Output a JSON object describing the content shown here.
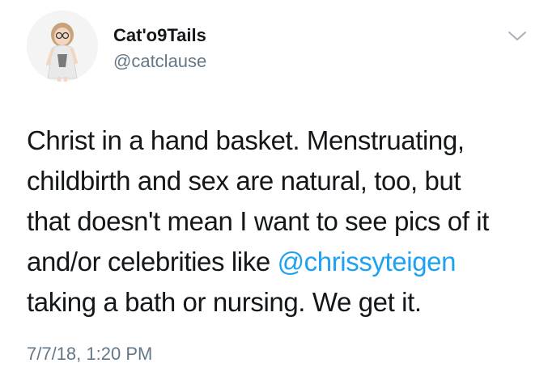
{
  "tweet": {
    "author": {
      "display_name": "Cat'o9Tails",
      "handle": "@catclause"
    },
    "menu_icon": "chevron-down-icon",
    "body": {
      "line1": "Christ in a hand basket. Menstruating,",
      "line2": "childbirth and sex are natural, too, but",
      "line3": "that doesn't mean I want to see pics of it",
      "line4_before": "and/or celebrities like ",
      "line4_mention": "@chrissyteigen",
      "line5": "taking a bath or nursing. We get it."
    },
    "timestamp": "7/7/18, 1:20 PM"
  },
  "colors": {
    "text": "#14171a",
    "secondary_text": "#657786",
    "link": "#1da1f2",
    "background": "#ffffff"
  }
}
